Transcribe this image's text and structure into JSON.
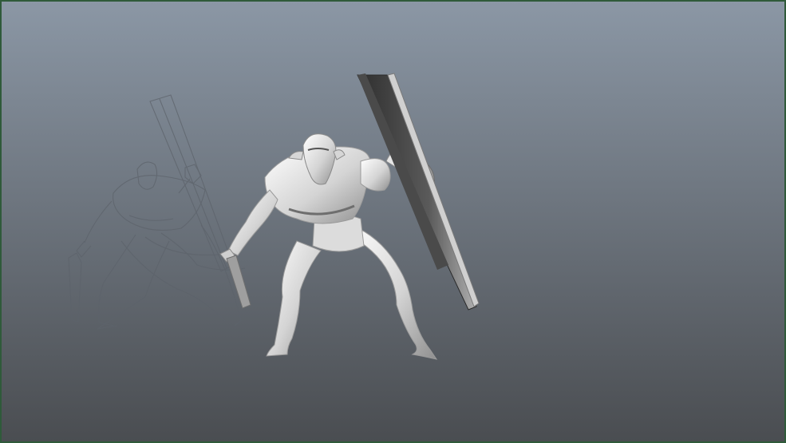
{
  "viewport": {
    "label": "",
    "frame_color": "#2f5a3a",
    "gradient_top": "#8b97a5",
    "gradient_bottom": "#4a4d51"
  },
  "scene": {
    "sketch_color": "#5a6068",
    "model_light": "#f2f2f2",
    "model_mid": "#c8c8c8",
    "model_dark": "#8d8d8d",
    "shield_dark": "#3b3b3b",
    "shield_light": "#9a9a9a"
  }
}
